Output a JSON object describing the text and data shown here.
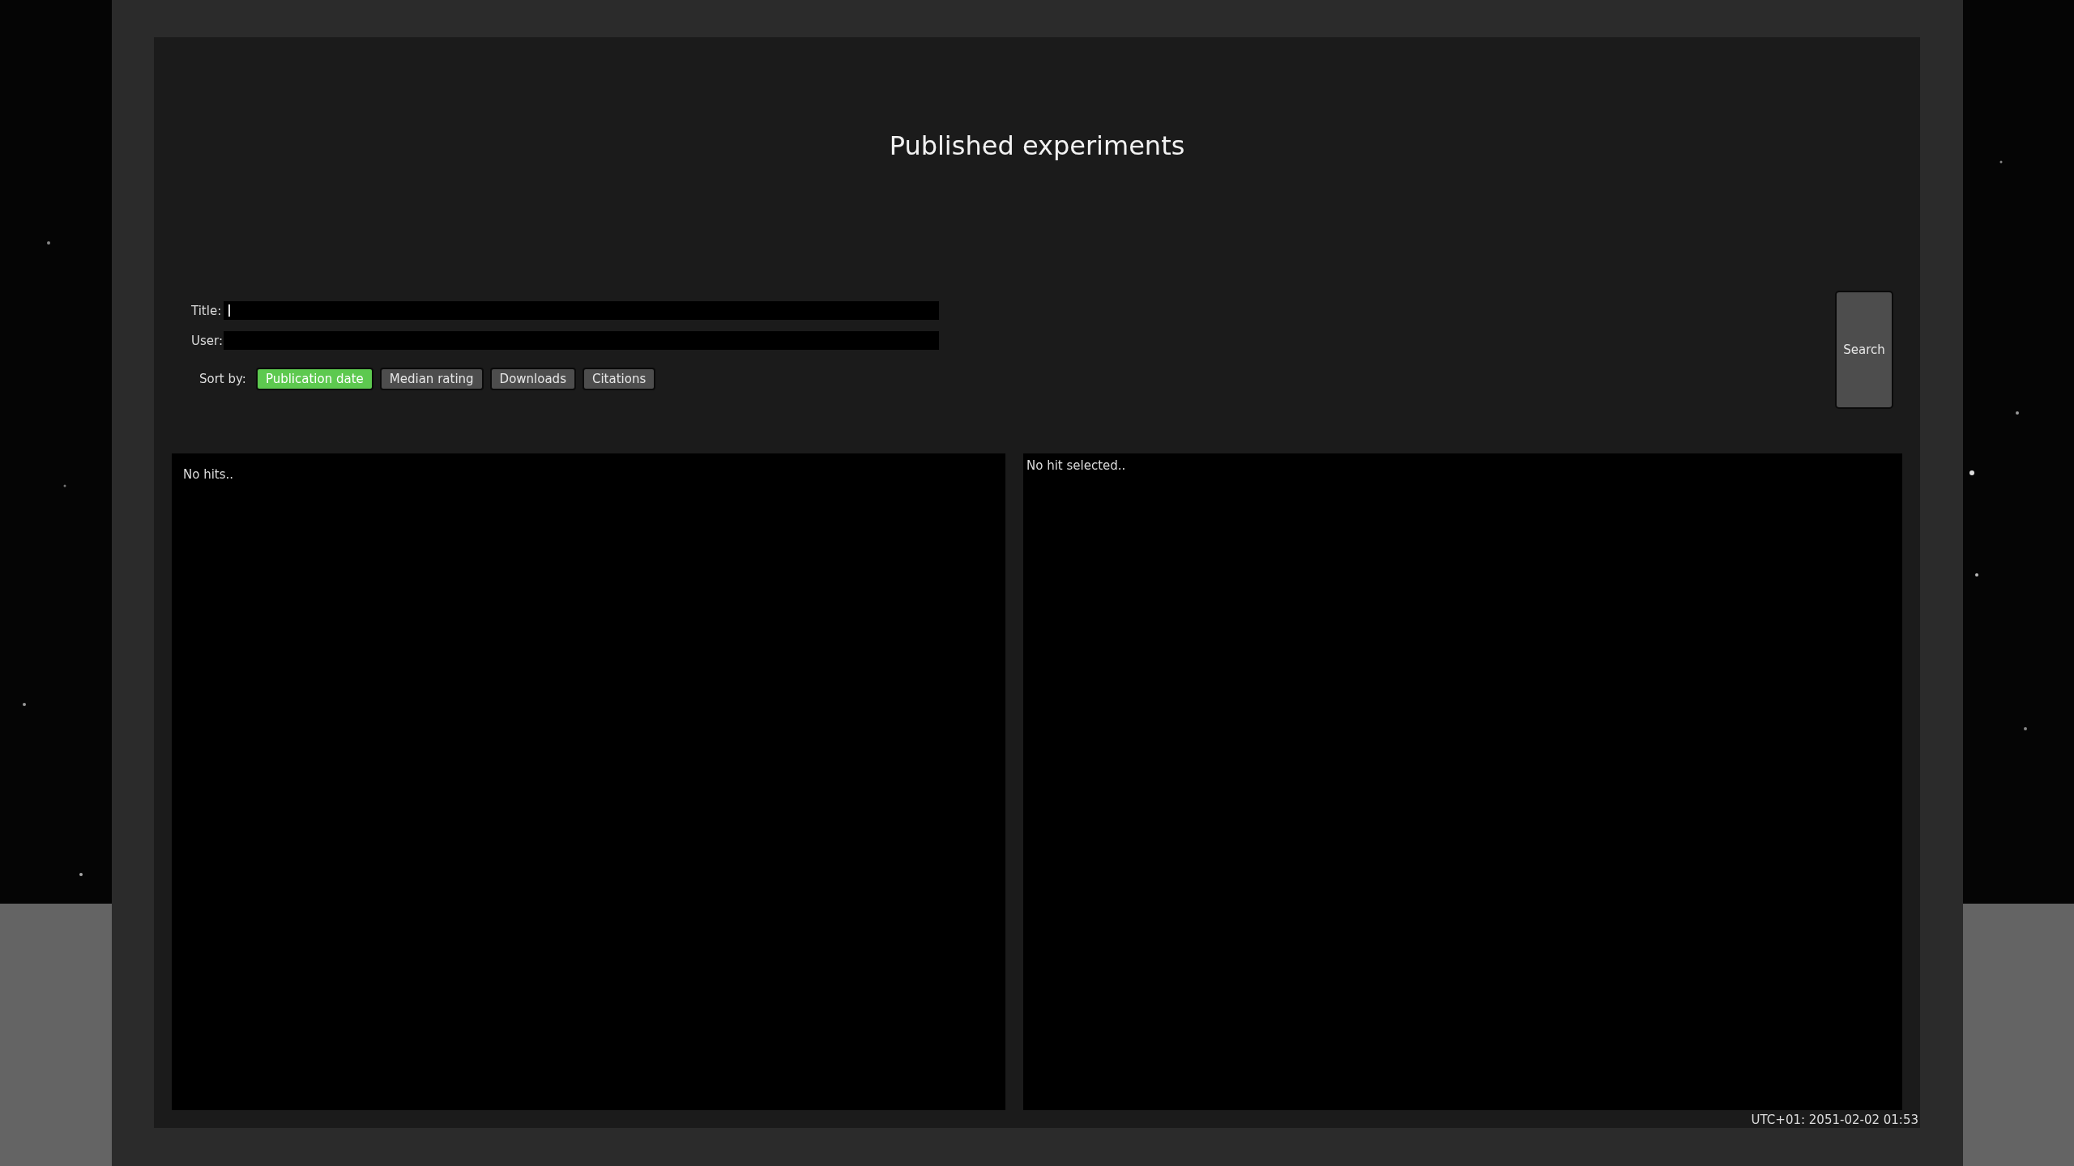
{
  "title": "Published experiments",
  "fields": [
    {
      "label": "Title:",
      "focused": true
    },
    {
      "label": "User:",
      "focused": false
    }
  ],
  "sort": {
    "label": "Sort by:",
    "options": [
      {
        "label": "Publication date",
        "selected": true
      },
      {
        "label": "Median rating",
        "selected": false
      },
      {
        "label": "Downloads",
        "selected": false
      },
      {
        "label": "Citations",
        "selected": false
      }
    ]
  },
  "search_button": "Search",
  "results": {
    "empty_text": "No hits.."
  },
  "detail": {
    "empty_text": "No hit selected.."
  },
  "timestamp": "UTC+01: 2051-02-02 01:53"
}
